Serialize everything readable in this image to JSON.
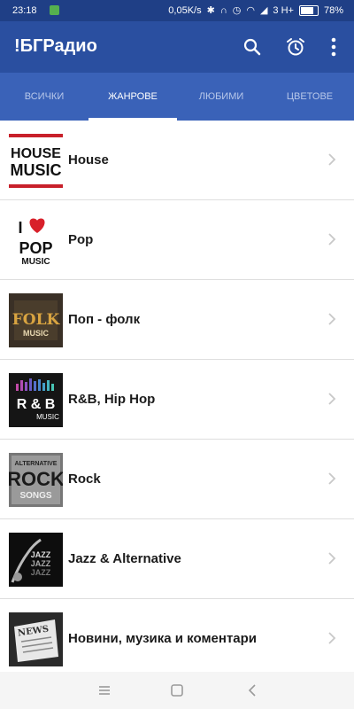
{
  "status_bar": {
    "time": "23:18",
    "network_speed": "0,05K/s",
    "carrier": "3 H+",
    "battery": "78%",
    "battery_level": 0.78
  },
  "app_bar": {
    "title": "!БГРадио",
    "icons": [
      "search-icon",
      "alarm-clock-icon",
      "more-vertical-icon"
    ]
  },
  "tabs": [
    {
      "label": "ВСИЧКИ",
      "active": false
    },
    {
      "label": "ЖАНРОВЕ",
      "active": true
    },
    {
      "label": "ЛЮБИМИ",
      "active": false
    },
    {
      "label": "ЦВЕТОВЕ",
      "active": false
    }
  ],
  "genres": [
    {
      "label": "House",
      "thumb": {
        "line1": "HOUSE",
        "line2": "MUSIC"
      }
    },
    {
      "label": "Pop",
      "thumb": {
        "line1": "I",
        "line2": "POP",
        "line3": "MUSIC"
      }
    },
    {
      "label": "Поп - фолк",
      "thumb": {
        "line1": "FOLK",
        "line2": "MUSIC"
      }
    },
    {
      "label": "R&B, Hip Hop",
      "thumb": {
        "line1": "R & B",
        "line2": "MUSIC"
      }
    },
    {
      "label": "Rock",
      "thumb": {
        "line1": "ALTERNATIVE",
        "line2": "ROCK",
        "line3": "SONGS"
      }
    },
    {
      "label": "Jazz & Alternative",
      "thumb": {
        "line1": "JAZZ",
        "line2": "JAZZ",
        "line3": "JAZZ"
      }
    },
    {
      "label": "Новини, музика и коментари",
      "thumb": {
        "line1": "NEWS"
      }
    }
  ],
  "colors": {
    "status_bar": "#1f3f86",
    "app_bar": "#2a4fa0",
    "tab_bar": "#3a62b8",
    "accent": "#ffffff"
  },
  "nav_bar": {
    "icons": [
      "menu-icon",
      "home-square-icon",
      "back-chevron-icon"
    ]
  }
}
